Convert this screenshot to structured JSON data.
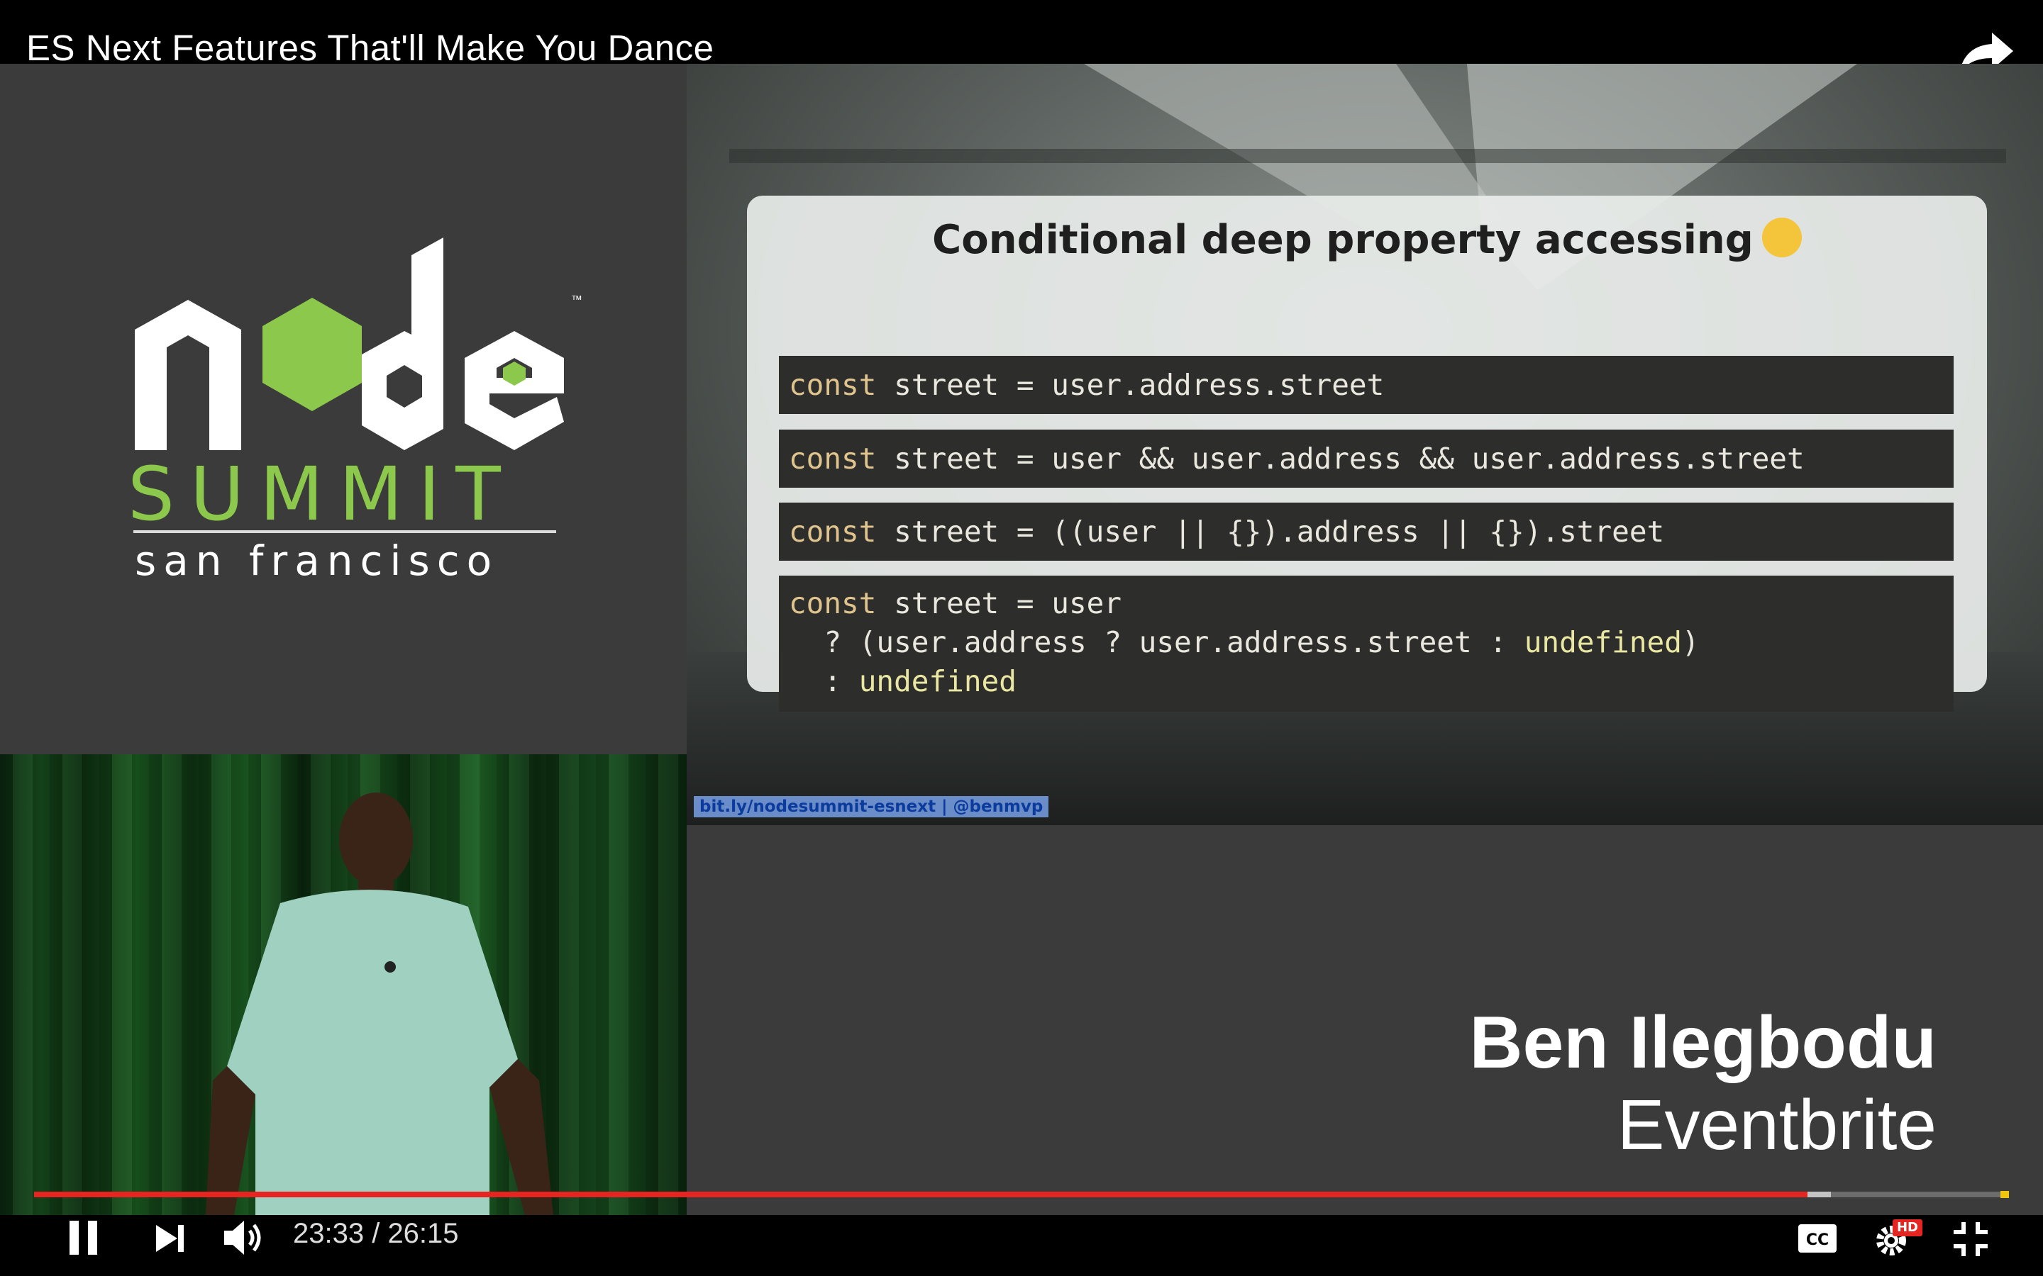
{
  "player": {
    "title": "ES Next Features That'll Make You Dance",
    "time_current": "23:33",
    "time_separator": "/",
    "time_total": "26:15",
    "time_display": "23:33 / 26:15",
    "played_fraction": 0.898,
    "buffered_fraction": 0.91,
    "hd_badge": "HD",
    "state": "playing",
    "accent_color": "#e52521",
    "icons": {
      "share": "share-arrow-icon",
      "pause": "pause-icon",
      "next": "next-icon",
      "volume": "volume-icon",
      "captions": "closed-captions-icon",
      "settings": "settings-gear-icon",
      "exit_fullscreen": "exit-fullscreen-icon"
    }
  },
  "logo": {
    "node_word": "node",
    "tm": "™",
    "summit": "SUMMIT",
    "location": "san francisco",
    "brand_green": "#8cc84b"
  },
  "slide": {
    "heading": "Conditional deep property accessing",
    "url_tag": "bit.ly/nodesummit-esnext | @benmvp",
    "code_blocks": [
      [
        "const street = user.address.street"
      ],
      [
        "const street = user && user.address && user.address.street"
      ],
      [
        "const street = ((user || {}).address || {}).street"
      ],
      [
        "const street = user",
        "  ? (user.address ? user.address.street : undefined)",
        "  : undefined"
      ]
    ]
  },
  "lower_third": {
    "name": "Ben Ilegbodu",
    "organization": "Eventbrite"
  }
}
